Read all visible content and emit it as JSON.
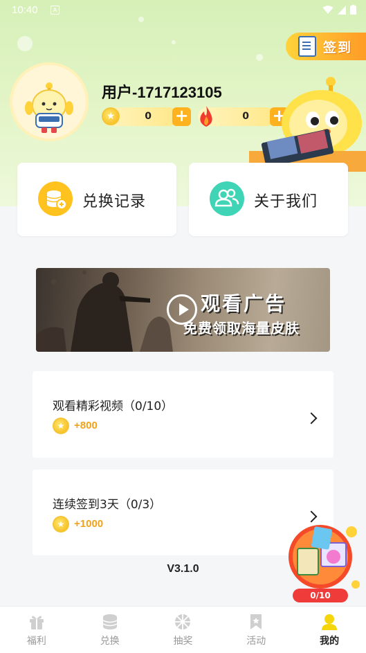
{
  "status": {
    "time": "10:40"
  },
  "header": {
    "checkin_label": "签到",
    "username": "用户-1717123105",
    "coins": "0",
    "fire": "0"
  },
  "cards": [
    {
      "label": "兑换记录",
      "icon": "coin-stack-icon",
      "color": "#ffc21f"
    },
    {
      "label": "关于我们",
      "icon": "users-icon",
      "color": "#3fd4b5"
    }
  ],
  "banner": {
    "title": "观看广告",
    "subtitle": "免费领取海量皮肤"
  },
  "tasks": [
    {
      "title": "观看精彩视频（0/10）",
      "reward": "+800"
    },
    {
      "title": "连续签到3天（0/3）",
      "reward": "+1000"
    }
  ],
  "version": "V3.1.0",
  "float": {
    "progress": "0/10"
  },
  "tabbar": {
    "tabs": [
      {
        "label": "福利",
        "icon": "gift-icon"
      },
      {
        "label": "兑换",
        "icon": "coins-icon"
      },
      {
        "label": "抽奖",
        "icon": "wheel-icon"
      },
      {
        "label": "活动",
        "icon": "bookmark-icon"
      },
      {
        "label": "我的",
        "icon": "profile-icon",
        "active": true
      }
    ]
  },
  "colors": {
    "accent": "#ffb21f",
    "hero_bg": "#d6f0b8",
    "reward": "#f0a21b",
    "badge": "#f03b3b"
  }
}
